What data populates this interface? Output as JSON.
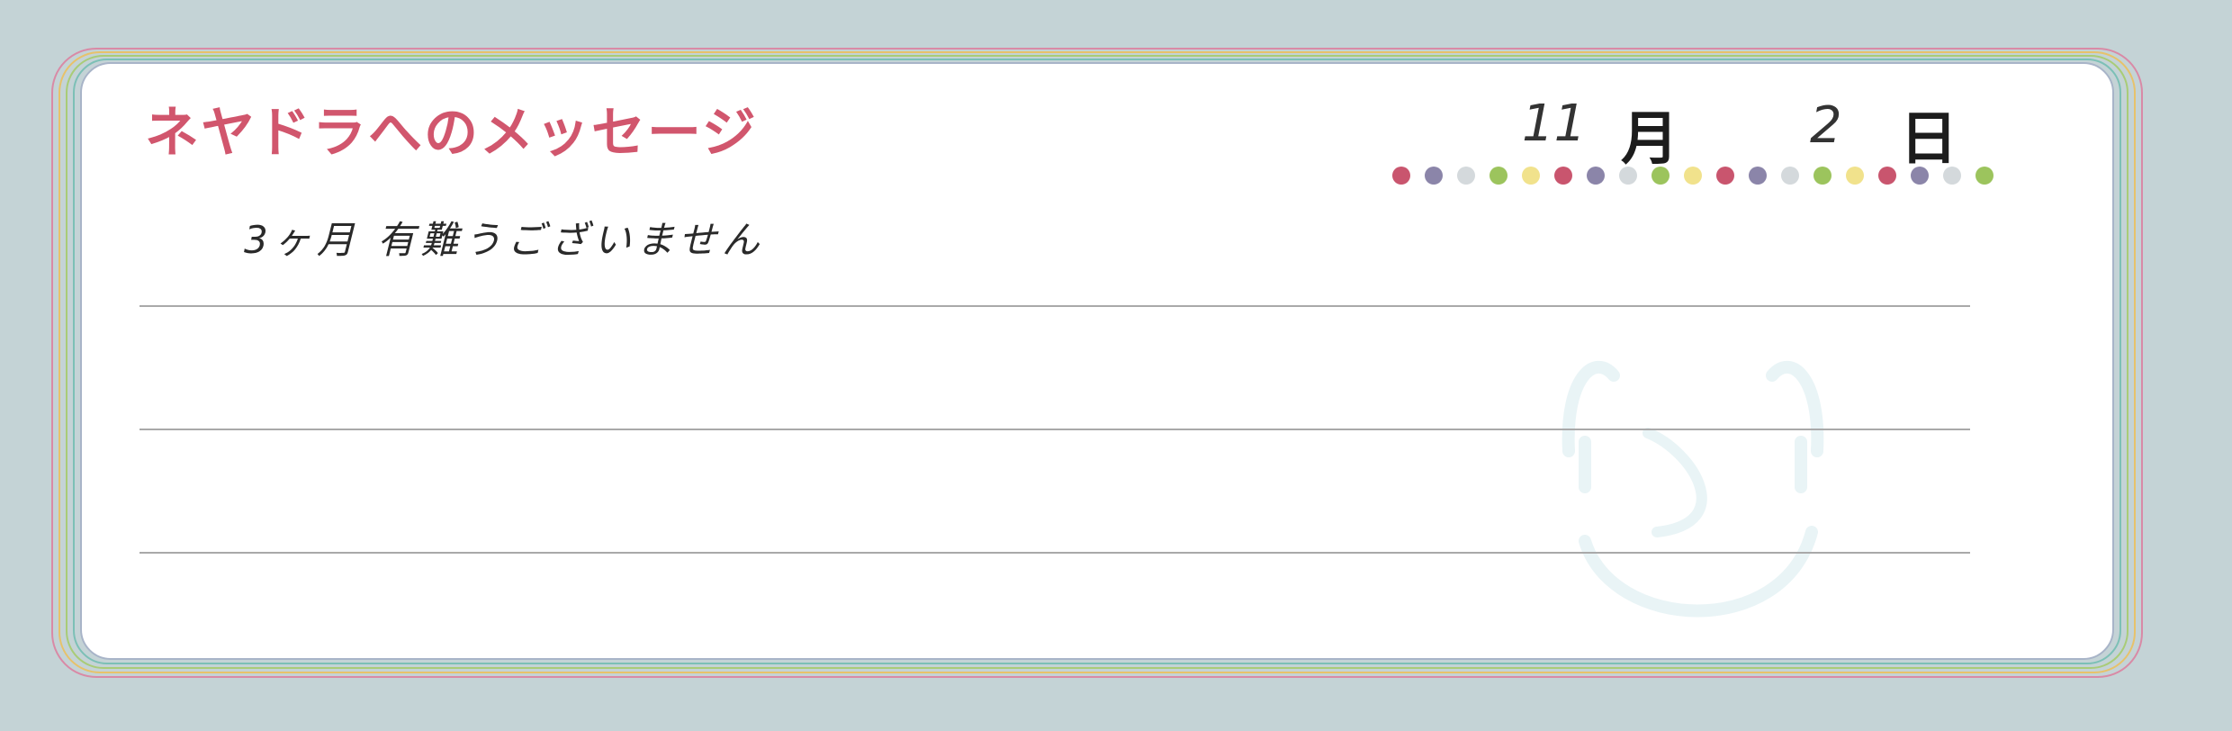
{
  "form": {
    "title": "ネヤドラへのメッセージ",
    "month_value": "11",
    "month_unit": "月",
    "day_value": "2",
    "day_unit": "日",
    "message": "3ヶ月 有難うございません"
  },
  "colors": {
    "title": "#d1566d",
    "background": "#c4d3d6",
    "card": "#ffffff",
    "ruled_line": "#a9a9a9",
    "dots": [
      "#c9556e",
      "#8b85a9",
      "#d4d9dc",
      "#9cc45d",
      "#f1e28c",
      "#c9556e",
      "#8b85a9",
      "#d4d9dc",
      "#9cc45d",
      "#f1e28c",
      "#c9556e",
      "#8b85a9",
      "#d4d9dc",
      "#9cc45d",
      "#f1e28c",
      "#c9556e",
      "#8b85a9",
      "#d4d9dc",
      "#9cc45d"
    ]
  },
  "icons": {
    "watermark": "smiley-face-icon"
  }
}
